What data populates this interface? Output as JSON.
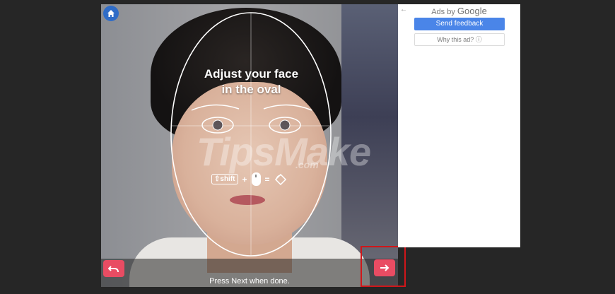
{
  "overlay": {
    "headline_line1": "Adjust your face",
    "headline_line2": "in the oval",
    "hint_key": "⇧shift",
    "hint_plus": "+",
    "hint_equals": "="
  },
  "watermark": {
    "main": "TipsMake",
    "suffix": ".com"
  },
  "footer": {
    "instruction": "Press Next when done."
  },
  "controls": {
    "home_icon": "home-icon",
    "undo_icon": "undo-arrow-icon",
    "next_icon": "right-arrow-icon"
  },
  "ad_panel": {
    "back_arrow": "←",
    "ads_by_prefix": "Ads by",
    "ads_by_brand": "Google",
    "send_feedback": "Send feedback",
    "why_this_ad": "Why this ad? ⓘ"
  },
  "colors": {
    "accent_button": "#e94c63",
    "home_button": "#2f6cc7",
    "highlight_border": "#d0161a",
    "send_feedback_bg": "#4a85e8"
  }
}
